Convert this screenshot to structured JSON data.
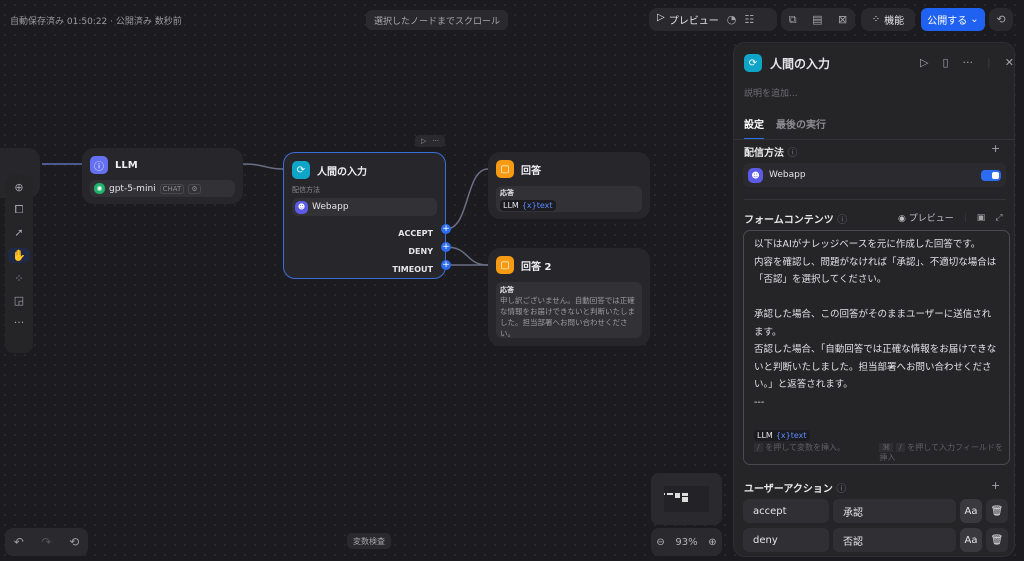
{
  "header": {
    "status": "自動保存済み 01:50:22 · 公開済み 数秒前",
    "scroll_button": "選択したノードまでスクロール",
    "preview": "プレビュー",
    "features": "機能",
    "publish": "公開する"
  },
  "nodes": {
    "llm": {
      "title": "LLM",
      "model": "gpt-5-mini",
      "model_badge": "CHAT"
    },
    "human": {
      "title": "人間の入力",
      "delivery_label": "配信方法",
      "delivery": "Webapp",
      "outputs": [
        "ACCEPT",
        "DENY",
        "TIMEOUT"
      ]
    },
    "answer1": {
      "title": "回答",
      "label": "応答",
      "var_node": "LLM",
      "var_name": "text"
    },
    "answer2": {
      "title": "回答 2",
      "label": "応答",
      "text": "申し訳ございません。自動回答では正確な情報をお届けできないと判断いたしました。担当部署へお問い合わせください。"
    }
  },
  "canvas_footer": {
    "variable_inspect": "変数検査",
    "zoom": "93%"
  },
  "panel": {
    "title": "人間の入力",
    "description_placeholder": "説明を追加...",
    "tabs": [
      {
        "label": "設定",
        "active": true
      },
      {
        "label": "最後の実行",
        "active": false
      }
    ],
    "delivery": {
      "heading": "配信方法",
      "method": "Webapp",
      "enabled": true
    },
    "form": {
      "heading": "フォームコンテンツ",
      "preview": "プレビュー",
      "lines": [
        "以下はAIがナレッジベースを元に作成した回答です。",
        "内容を確認し、問題がなければ「承認」、不適切な場合は「否認」を選択してください。",
        "",
        "承認した場合、この回答がそのままユーザーに送信されます。",
        "否認した場合、「自動回答では正確な情報をお届けできないと判断いたしました。担当部署へお問い合わせください。」と返答されます。",
        "---"
      ],
      "var_node": "LLM",
      "var_name": "text",
      "hint_var": "を押して変数を挿入。",
      "hint_field": "を押して入力フィールドを挿入",
      "key_slash": "/",
      "key_cmd": "⌘"
    },
    "actions": {
      "heading": "ユーザーアクション",
      "items": [
        {
          "id": "accept",
          "label": "承認"
        },
        {
          "id": "deny",
          "label": "否認"
        }
      ]
    }
  },
  "colors": {
    "accent": "#1f62f2",
    "human_icon": "#0fa5c9",
    "llm_icon": "#6470f2",
    "answer_icon": "#f59a12",
    "webapp_icon": "#5b5be8",
    "model_icon": "#1fb36b"
  }
}
